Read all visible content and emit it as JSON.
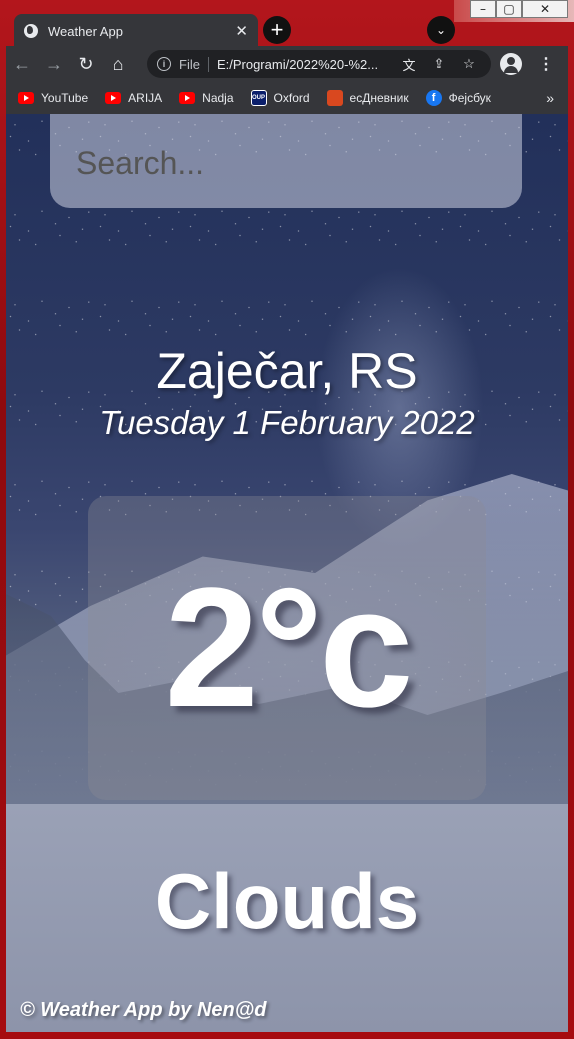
{
  "window": {
    "minimize_glyph": "–",
    "maximize_glyph": "▢",
    "close_glyph": "✕"
  },
  "tab": {
    "title": "Weather App",
    "close_glyph": "✕",
    "icon": "globe-icon"
  },
  "new_tab_glyph": "+",
  "tab_search_glyph": "⌄",
  "toolbar": {
    "back_glyph": "←",
    "forward_glyph": "→",
    "reload_glyph": "↻",
    "home_glyph": "⌂",
    "scheme": "File",
    "url": "E:/Programi/2022%20-%2...",
    "translate_glyph": "文",
    "share_glyph": "⇪",
    "star_glyph": "☆",
    "menu_glyph": "⋮"
  },
  "bookmarks": [
    {
      "label": "YouTube",
      "icon": "youtube"
    },
    {
      "label": "ARIJA",
      "icon": "youtube"
    },
    {
      "label": "Nadja",
      "icon": "youtube"
    },
    {
      "label": "Oxford",
      "icon": "oup"
    },
    {
      "label": "есДневник",
      "icon": "ednevnik"
    },
    {
      "label": "Фејсбук",
      "icon": "facebook"
    }
  ],
  "bookmarks_more": "»",
  "oup_text": "OUP",
  "fb_text": "f",
  "page": {
    "search_placeholder": "Search...",
    "location": "Zaječar, RS",
    "date": "Tuesday 1 February 2022",
    "temperature": "2°c",
    "weather": "Clouds",
    "footer": "© Weather App by Nen@d"
  }
}
